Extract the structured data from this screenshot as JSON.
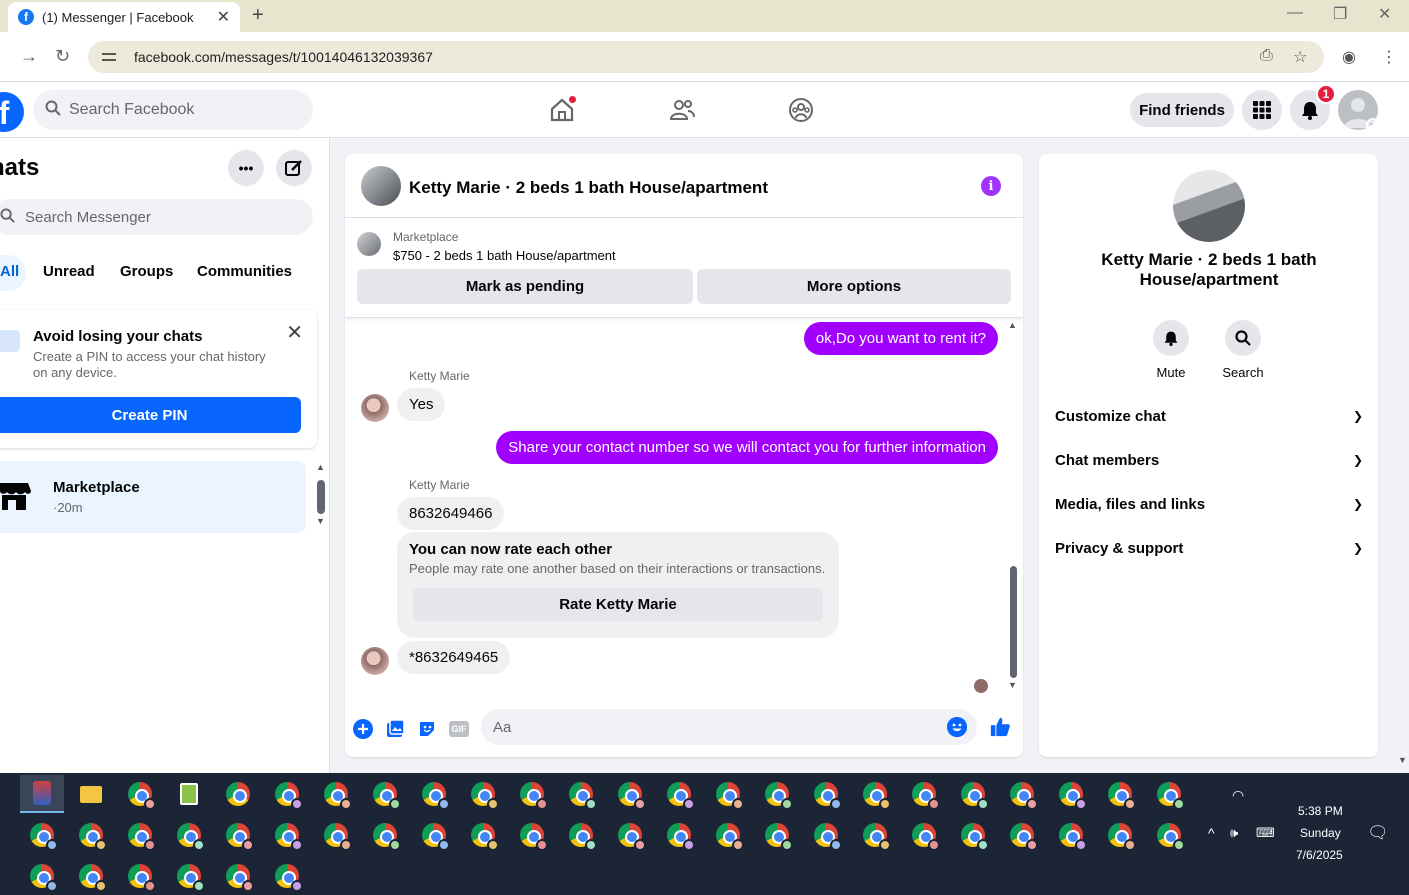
{
  "browser": {
    "tab_title": "(1) Messenger | Facebook",
    "url": "facebook.com/messages/t/10014046132039367"
  },
  "fb": {
    "search_placeholder": "Search Facebook",
    "find_friends": "Find friends",
    "notification_count": "1"
  },
  "sidebar": {
    "title": "hats",
    "search_placeholder": "Search Messenger",
    "filters": [
      "All",
      "Unread",
      "Groups",
      "Communities"
    ],
    "pin_card": {
      "title": "Avoid losing your chats",
      "description": "Create a PIN to access your chat history on any device.",
      "button": "Create PIN"
    },
    "conversation": {
      "name": "Marketplace",
      "time": "·20m"
    }
  },
  "chat": {
    "title": "Ketty Marie · 2 beds 1 bath House/apartment",
    "marketplace_label": "Marketplace",
    "listing": "$750 - 2 beds 1 bath House/apartment",
    "mark_pending": "Mark as pending",
    "more_options": "More options",
    "messages": {
      "out1": "ok,Do you want to rent it?",
      "sender1": "Ketty Marie",
      "in1": "Yes",
      "out2": "Share your contact number so we will contact you for further information",
      "sender2": "Ketty Marie",
      "in2": "8632649466",
      "in3": "*8632649465"
    },
    "rate_card": {
      "title": "You can now rate each other",
      "description": "People may rate one another based on their interactions or transactions.",
      "button": "Rate Ketty Marie"
    },
    "composer_placeholder": "Aa",
    "gif_label": "GIF"
  },
  "details": {
    "name": "Ketty Marie · 2 beds 1 bath House/apartment",
    "actions": [
      "Mute",
      "Search"
    ],
    "sections": [
      "Customize chat",
      "Chat members",
      "Media, files and links",
      "Privacy & support"
    ]
  },
  "taskbar": {
    "time": "5:38 PM",
    "day": "Sunday",
    "date": "7/6/2025"
  },
  "colors": {
    "accent_purple": "#a100ff",
    "fb_blue": "#0866ff",
    "badge_red": "#e41e3f"
  }
}
